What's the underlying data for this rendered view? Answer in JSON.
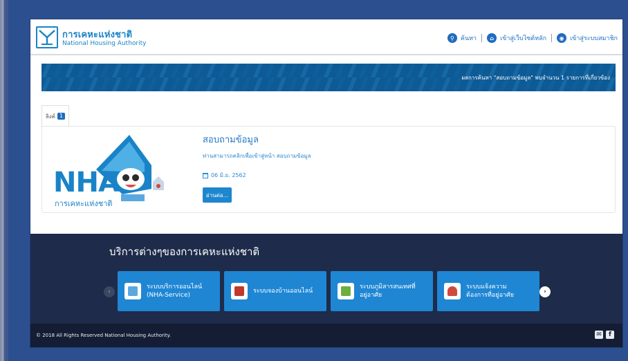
{
  "header": {
    "logo_th": "การเคหะแห่งชาติ",
    "logo_en": "National Housing Authority",
    "nav": [
      {
        "icon": "search-icon",
        "label": "ค้นหา"
      },
      {
        "icon": "home-icon",
        "label": "เข้าสู่เว็บไซต์หลัก"
      },
      {
        "icon": "globe-icon",
        "label": "เข้าสู่ระบบสมาชิก"
      }
    ]
  },
  "banner": {
    "text": "ผลการค้นหา \"สอบถามข้อมูล\" พบจำนวน 1 รายการที่เกี่ยวข้อง"
  },
  "tabs": [
    {
      "label": "ลิงค์",
      "count": "1"
    }
  ],
  "result": {
    "logo_letters": "NHA",
    "logo_caption": "การเคหะแห่งชาติ",
    "title": "สอบถามข้อมูล",
    "description": "ท่านสามารถคลิกเพื่อเข้าสู่หน้า สอบถามข้อมูล",
    "date": "06 มิ.ย. 2562",
    "button": "อ่านต่อ..."
  },
  "services": {
    "title": "บริการต่างๆของการเคหะแห่งชาติ",
    "prev_arrow": "‹",
    "next_arrow": "›",
    "items": [
      {
        "line1": "ระบบบริการออนไลน์",
        "line2": "(NHA-Service)"
      },
      {
        "line1": "ระบบจองบ้านออนไลน์",
        "line2": ""
      },
      {
        "line1": "ระบบภูมิสารสนเทศที่",
        "line2": "อยู่อาศัย"
      },
      {
        "line1": "ระบบแจ้งความ",
        "line2": "ต้องการที่อยู่อาศัย"
      }
    ]
  },
  "footer": {
    "copyright": "© 2018 All Rights Reserved National Housing Authority."
  },
  "colors": {
    "brand_blue": "#1a83c7",
    "banner_blue": "#0d5a95",
    "service_bg": "#1e2b4a",
    "footer_bg": "#141d33",
    "card_blue": "#1f86d4"
  }
}
